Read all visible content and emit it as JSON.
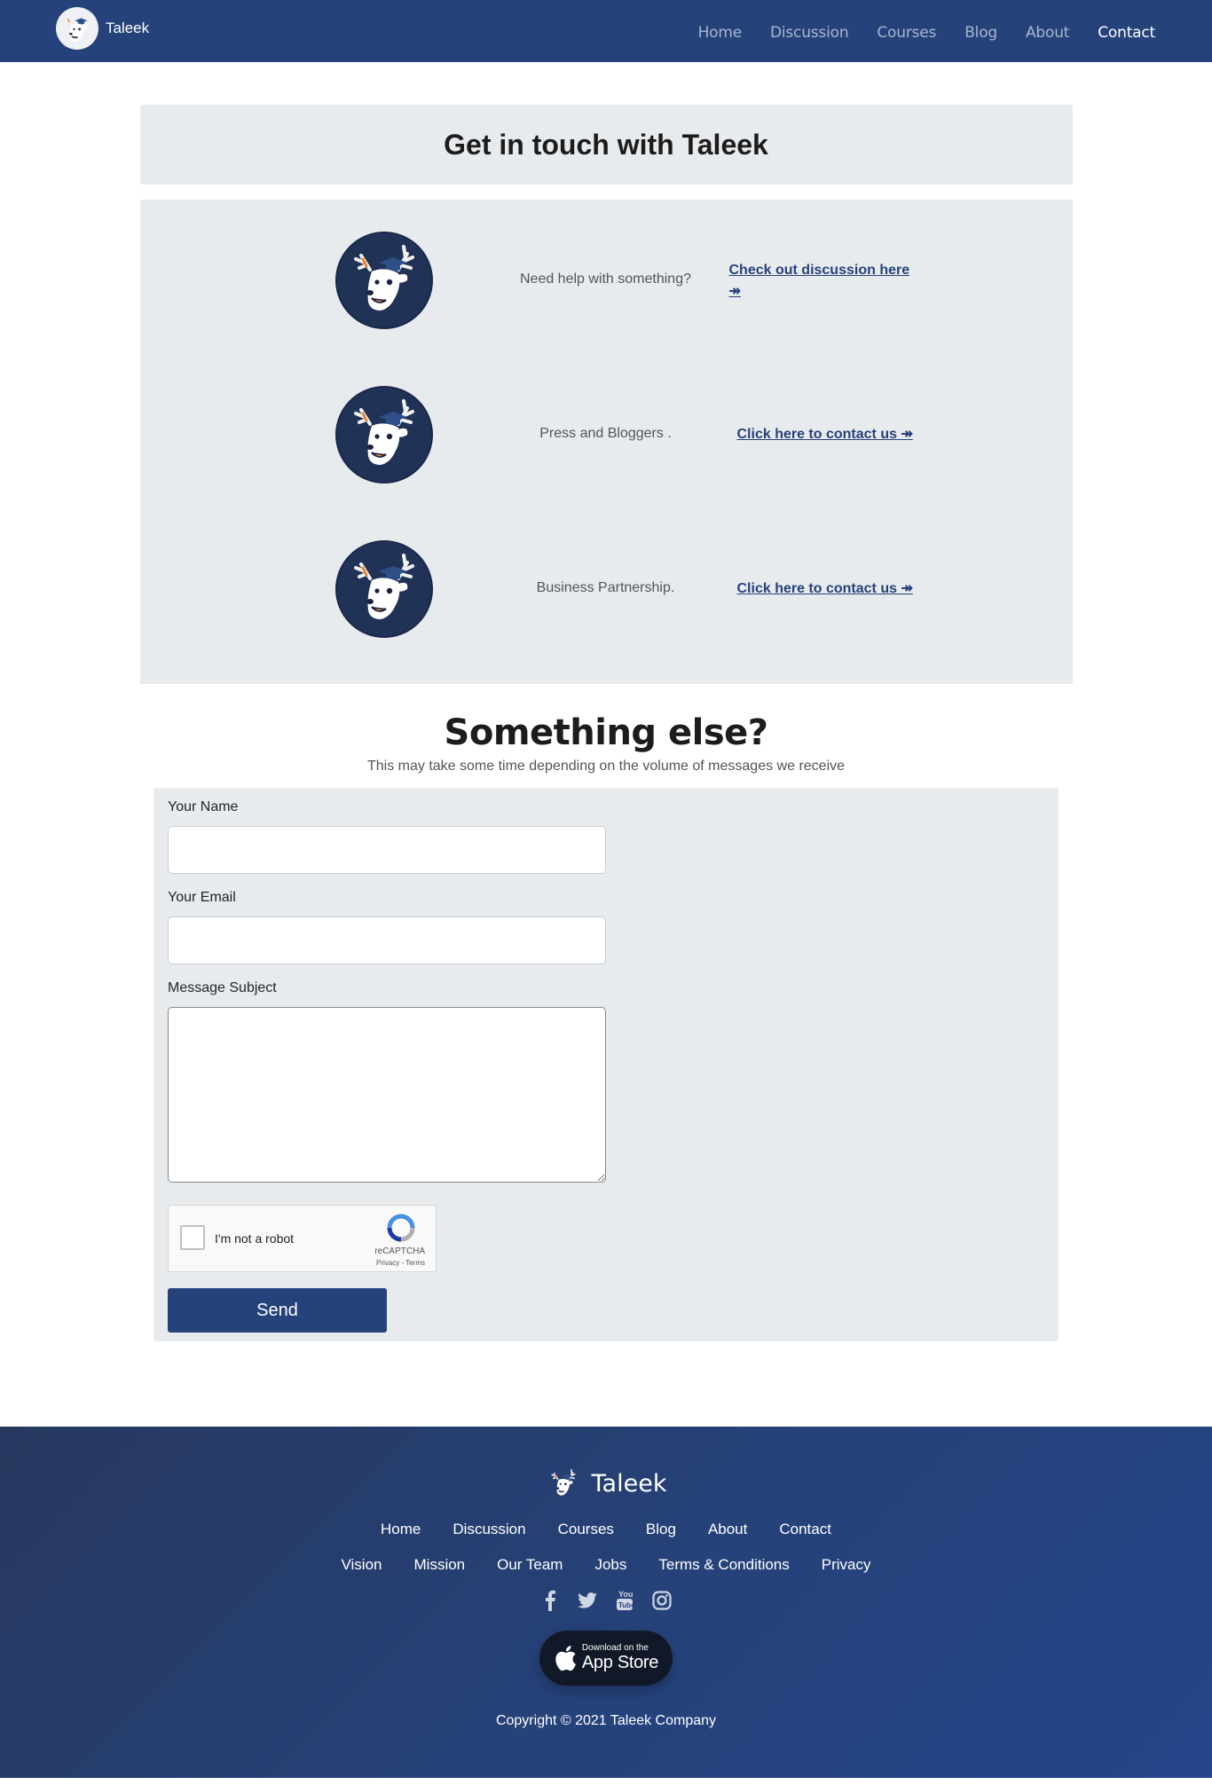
{
  "nav": {
    "brand": "Taleek",
    "links": [
      {
        "label": "Home",
        "active": false
      },
      {
        "label": "Discussion",
        "active": false
      },
      {
        "label": "Courses",
        "active": false
      },
      {
        "label": "Blog",
        "active": false
      },
      {
        "label": "About",
        "active": false
      },
      {
        "label": "Contact",
        "active": true
      }
    ]
  },
  "header": {
    "title": "Get in touch with Taleek"
  },
  "contacts": [
    {
      "text": "Need help with something?",
      "link": "Check out discussion here ↠"
    },
    {
      "text": "Press and Bloggers .",
      "link": "Click here to contact us ↠"
    },
    {
      "text": "Business Partnership.",
      "link": "Click here to contact us ↠"
    }
  ],
  "form": {
    "title": "Something else?",
    "subtitle": "This may take some time depending on the volume of messages we receive",
    "name_label": "Your Name",
    "email_label": "Your Email",
    "subject_label": "Message Subject",
    "name_value": "",
    "email_value": "",
    "subject_value": "",
    "captcha_label": "I'm not a robot",
    "captcha_brand": "reCAPTCHA",
    "captcha_links": "Privacy - Terms",
    "send_label": "Send"
  },
  "footer": {
    "brand": "Taleek",
    "links_row1": [
      "Home",
      "Discussion",
      "Courses",
      "Blog",
      "About",
      "Contact"
    ],
    "links_row2": [
      "Vision",
      "Mission",
      "Our Team",
      "Jobs",
      "Terms & Conditions",
      "Privacy"
    ],
    "socials": [
      "facebook-icon",
      "twitter-icon",
      "youtube-icon",
      "instagram-icon"
    ],
    "appstore_small": "Download on the",
    "appstore_big": "App Store",
    "copyright": "Copyright © 2021 Taleek Company"
  },
  "colors": {
    "primary": "#26427a",
    "panel": "#e8ebee"
  }
}
